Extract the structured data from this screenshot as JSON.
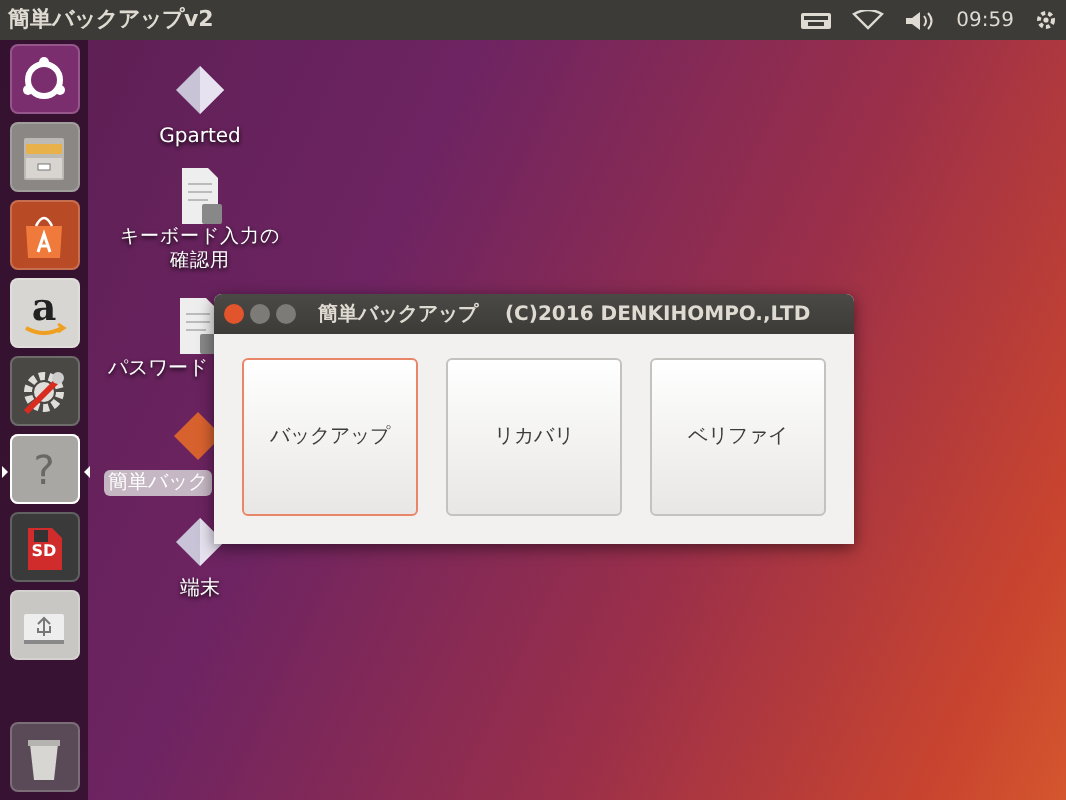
{
  "top_panel": {
    "title": "簡単バックアップv2",
    "clock": "09:59"
  },
  "launcher": [
    {
      "kind": "ubuntu",
      "focused": false
    },
    {
      "kind": "files",
      "focused": false
    },
    {
      "kind": "software",
      "focused": false
    },
    {
      "kind": "amazon",
      "glyph": "a",
      "focused": false
    },
    {
      "kind": "settings",
      "focused": false
    },
    {
      "kind": "help",
      "glyph": "?",
      "focused": true
    },
    {
      "kind": "sdcard",
      "glyph": "SD",
      "focused": false
    },
    {
      "kind": "usb",
      "focused": false
    },
    {
      "kind": "trash",
      "focused": false
    }
  ],
  "desktop_icons": [
    {
      "label": "Gparted",
      "kind": "diamond",
      "selected": false
    },
    {
      "label": "キーボード入力の確認用",
      "kind": "document",
      "selected": false
    },
    {
      "label": "パスワード",
      "kind": "document",
      "selected": false
    },
    {
      "label": "簡単バック",
      "kind": "app",
      "selected": true
    },
    {
      "label": "端末",
      "kind": "diamond",
      "selected": false
    }
  ],
  "window": {
    "title": "簡単バックアップ　 (C)2016 DENKIHOMPO.,LTD",
    "buttons": [
      {
        "label": "バックアップ",
        "focused": true
      },
      {
        "label": "リカバリ",
        "focused": false
      },
      {
        "label": "ベリファイ",
        "focused": false
      }
    ]
  }
}
